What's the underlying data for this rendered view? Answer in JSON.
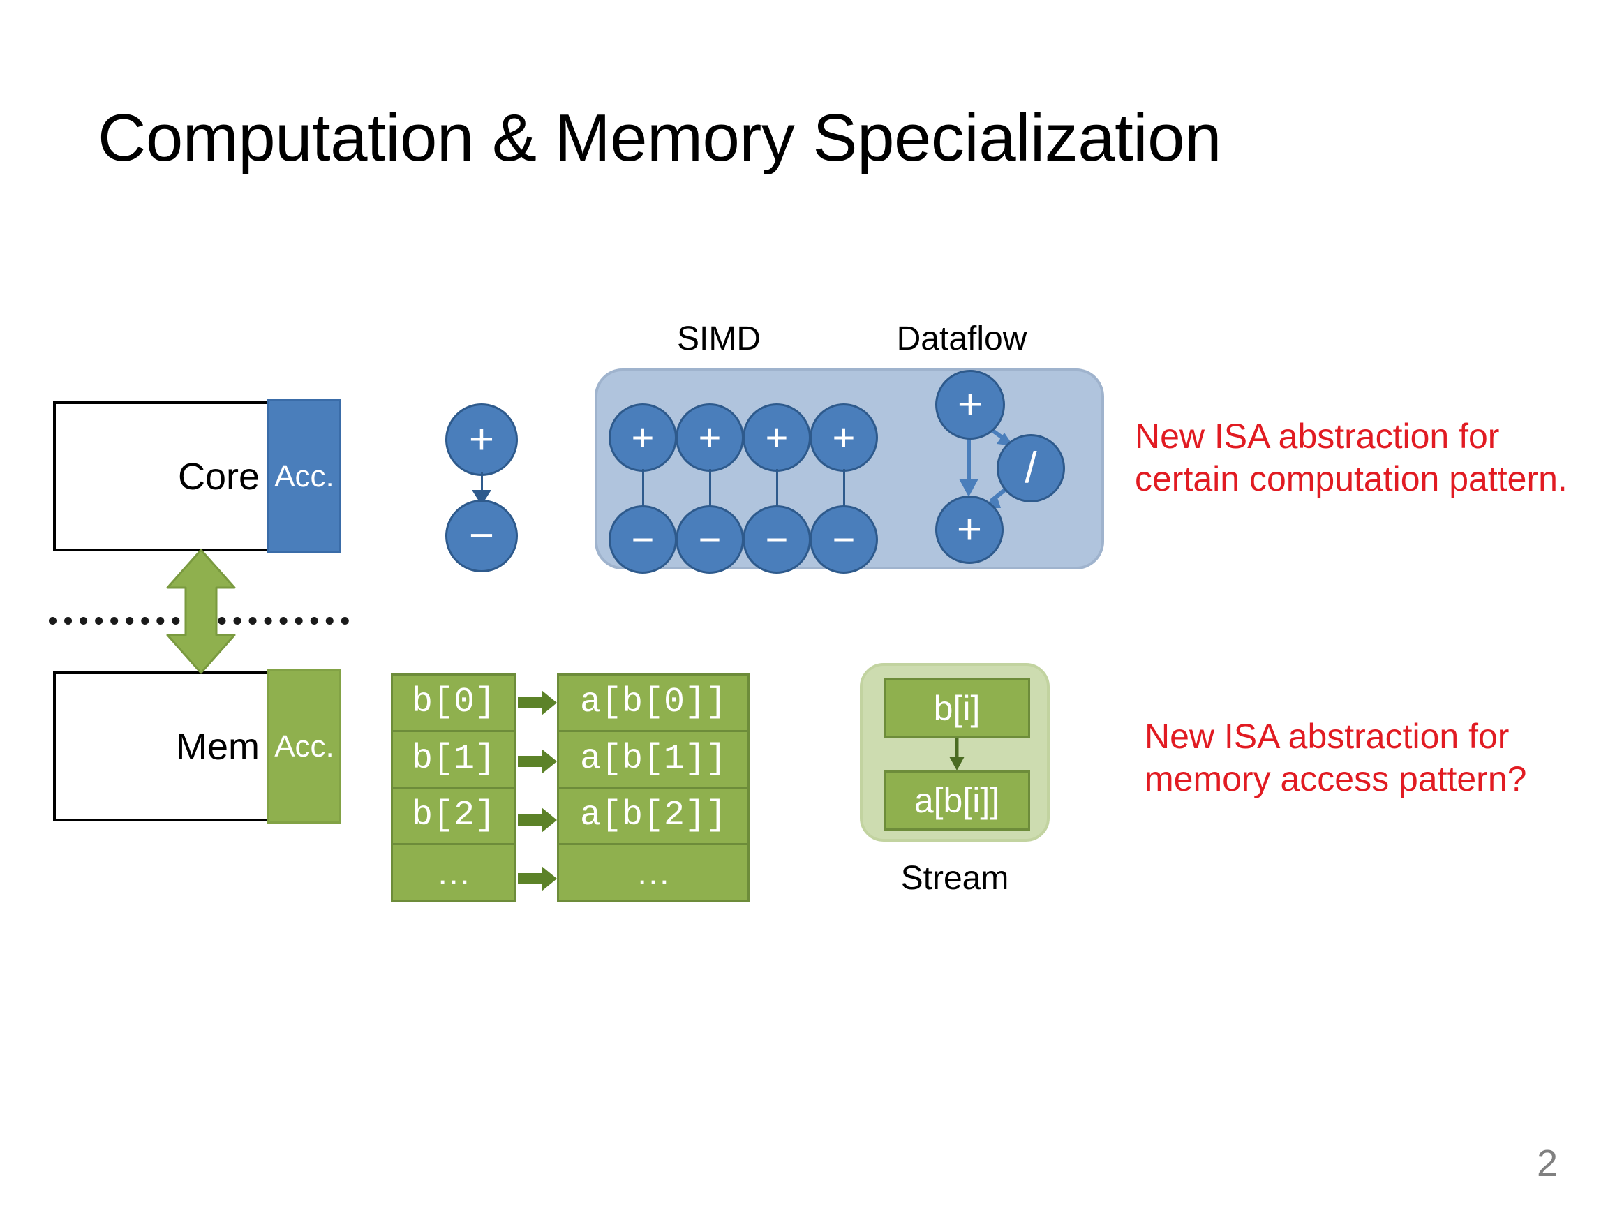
{
  "slide": {
    "title": "Computation & Memory Specialization",
    "page_number": "2",
    "background_color": "#ffffff"
  },
  "hardware": {
    "core_block": {
      "label": "Core",
      "accelerator_label": "Acc.",
      "accelerator_color": "#4a7ebb"
    },
    "mem_block": {
      "label": "Mem",
      "accelerator_label": "Acc.",
      "accelerator_color": "#8fb04e"
    },
    "interconnect_arrow_color": "#8fb04e",
    "divider_style": "dotted"
  },
  "compute": {
    "single_pair": {
      "top_op": "+",
      "bottom_op": "−"
    },
    "simd": {
      "label": "SIMD",
      "lanes": 4,
      "top_row_ops": [
        "+",
        "+",
        "+",
        "+"
      ],
      "bottom_row_ops": [
        "−",
        "−",
        "−",
        "−"
      ]
    },
    "dataflow": {
      "label": "Dataflow",
      "nodes": [
        {
          "id": "top-add",
          "op": "+"
        },
        {
          "id": "div",
          "op": "/"
        },
        {
          "id": "bottom-add",
          "op": "+"
        }
      ],
      "edges": [
        {
          "from": "top-add",
          "to": "div"
        },
        {
          "from": "top-add",
          "to": "bottom-add"
        },
        {
          "from": "div",
          "to": "bottom-add"
        }
      ]
    },
    "container_color": "#b0c4dd",
    "node_color": "#4a7ebb"
  },
  "memory": {
    "indirect_table": {
      "index_column": [
        "b[0]",
        "b[1]",
        "b[2]",
        "…"
      ],
      "value_column": [
        "a[b[0]]",
        "a[b[1]]",
        "a[b[2]]",
        "…"
      ]
    },
    "stream": {
      "label": "Stream",
      "cells": [
        "b[i]",
        "a[b[i]]"
      ]
    },
    "cell_color": "#8fb04e",
    "stream_container_color": "#cddcb0"
  },
  "annotations": {
    "compute_note": "New ISA abstraction for\ncertain computation pattern.",
    "memory_note": "New ISA abstraction for\nmemory access pattern?",
    "note_color": "#e11b22"
  }
}
